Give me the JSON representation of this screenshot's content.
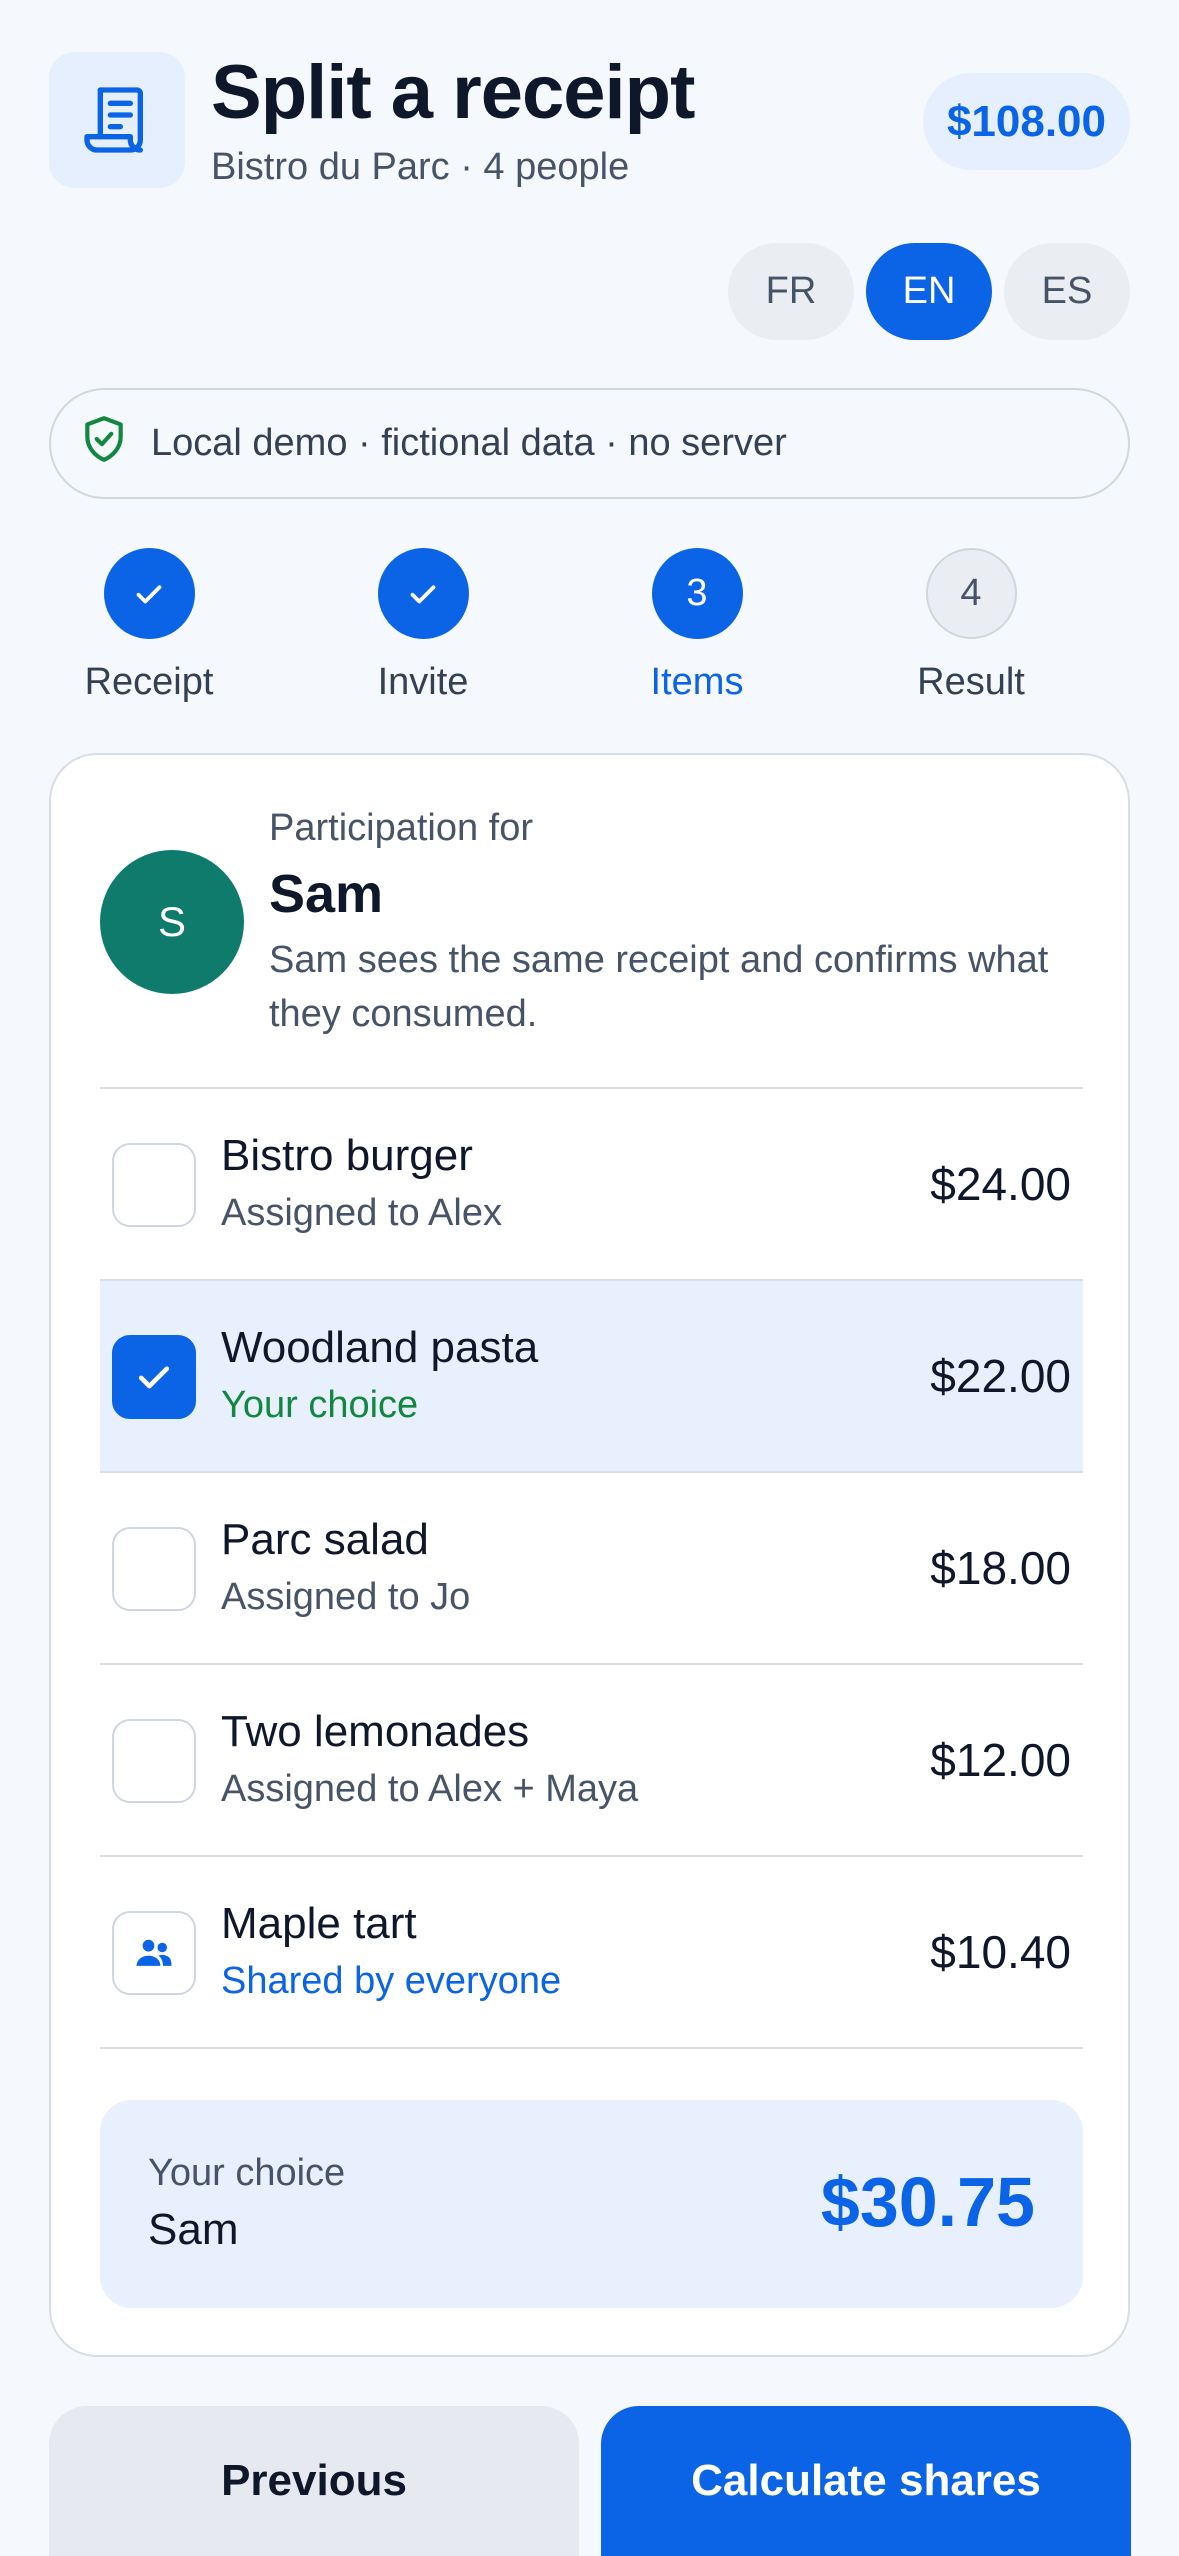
{
  "header": {
    "title": "Split a receipt",
    "subtitle": "Bistro du Parc · 4 people",
    "total": "$108.00",
    "icon": "receipt-icon"
  },
  "languages": [
    {
      "label": "FR",
      "active": false
    },
    {
      "label": "EN",
      "active": true
    },
    {
      "label": "ES",
      "active": false
    }
  ],
  "banner": {
    "text": "Local demo · fictional data · no server",
    "icon": "shield-check-icon",
    "icon_color": "#12873f"
  },
  "steps": [
    {
      "label": "Receipt",
      "state": "done",
      "number": ""
    },
    {
      "label": "Invite",
      "state": "done",
      "number": ""
    },
    {
      "label": "Items",
      "state": "current",
      "number": "3"
    },
    {
      "label": "Result",
      "state": "todo",
      "number": "4"
    }
  ],
  "participant": {
    "label": "Participation for",
    "name": "Sam",
    "initial": "S",
    "description": "Sam sees the same receipt and confirms what they consumed.",
    "avatar_color": "#0f7b6c"
  },
  "items": [
    {
      "name": "Bistro burger",
      "sub": "Assigned to Alex",
      "price": "$24.00",
      "state": "unchecked"
    },
    {
      "name": "Woodland pasta",
      "sub": "Your choice",
      "price": "$22.00",
      "state": "checked"
    },
    {
      "name": "Parc salad",
      "sub": "Assigned to Jo",
      "price": "$18.00",
      "state": "unchecked"
    },
    {
      "name": "Two lemonades",
      "sub": "Assigned to Alex + Maya",
      "price": "$12.00",
      "state": "unchecked"
    },
    {
      "name": "Maple tart",
      "sub": "Shared by everyone",
      "price": "$10.40",
      "state": "shared"
    }
  ],
  "summary": {
    "label": "Your choice",
    "name": "Sam",
    "amount": "$30.75"
  },
  "actions": {
    "previous": "Previous",
    "calculate": "Calculate shares"
  },
  "colors": {
    "accent": "#0b63e5",
    "success": "#12873f",
    "selected_row": "#e8f0fd"
  }
}
